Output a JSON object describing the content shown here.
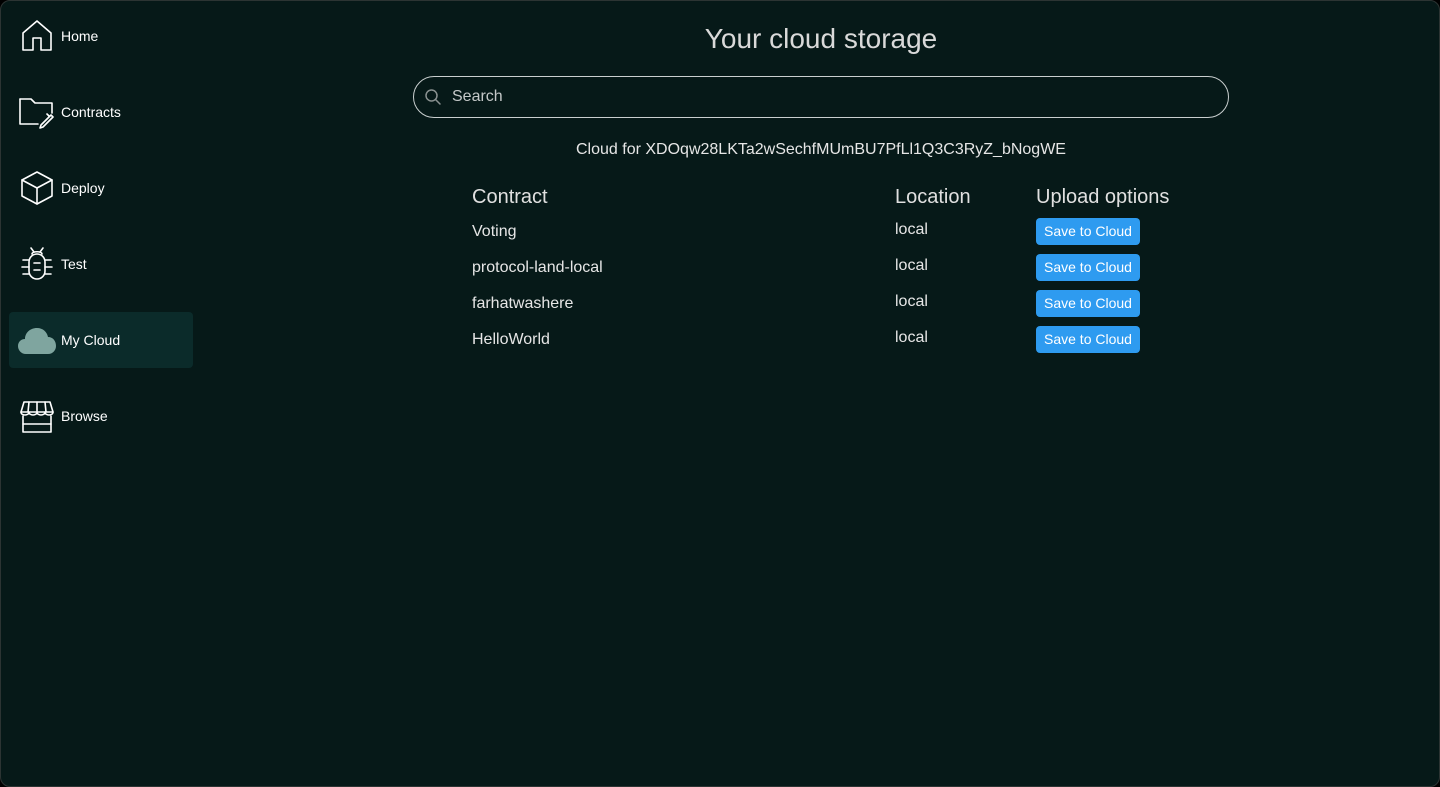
{
  "sidebar": {
    "items": [
      {
        "label": "Home",
        "icon": "home-icon",
        "active": false
      },
      {
        "label": "Contracts",
        "icon": "folder-edit-icon",
        "active": false
      },
      {
        "label": "Deploy",
        "icon": "cube-icon",
        "active": false
      },
      {
        "label": "Test",
        "icon": "bug-icon",
        "active": false
      },
      {
        "label": "My Cloud",
        "icon": "cloud-icon",
        "active": true
      },
      {
        "label": "Browse",
        "icon": "storefront-icon",
        "active": false
      }
    ]
  },
  "main": {
    "title": "Your cloud storage",
    "search": {
      "placeholder": "Search",
      "value": ""
    },
    "cloud_for": "Cloud for XDOqw28LKTa2wSechfMUmBU7PfLl1Q3C3RyZ_bNogWE",
    "table": {
      "headers": {
        "contract": "Contract",
        "location": "Location",
        "upload": "Upload options"
      },
      "rows": [
        {
          "contract": "Voting",
          "location": "local",
          "action": "Save to Cloud"
        },
        {
          "contract": "protocol-land-local",
          "location": "local",
          "action": "Save to Cloud"
        },
        {
          "contract": "farhatwashere",
          "location": "local",
          "action": "Save to Cloud"
        },
        {
          "contract": "HelloWorld",
          "location": "local",
          "action": "Save to Cloud"
        }
      ]
    }
  },
  "colors": {
    "background": "#061918",
    "active_nav": "#0b2b2a",
    "button": "#2e9bf0",
    "cloud_icon": "#7fa59f"
  }
}
